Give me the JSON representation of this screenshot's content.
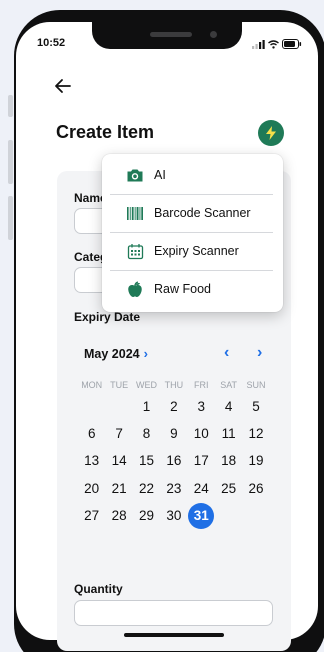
{
  "status": {
    "time": "10:52"
  },
  "header": {
    "title": "Create Item"
  },
  "form": {
    "name_label": "Name",
    "category_label": "Category",
    "expiry_label": "Expiry Date",
    "quantity_label": "Quantity"
  },
  "calendar": {
    "month_label": "May 2024",
    "weekdays": [
      "MON",
      "TUE",
      "WED",
      "THU",
      "FRI",
      "SAT",
      "SUN"
    ],
    "leading_blanks": 2,
    "days_in_month": 31,
    "selected_day": 31
  },
  "menu": {
    "items": [
      {
        "label": "AI",
        "icon": "camera-icon"
      },
      {
        "label": "Barcode Scanner",
        "icon": "barcode-icon"
      },
      {
        "label": "Expiry Scanner",
        "icon": "calendar-icon"
      },
      {
        "label": "Raw Food",
        "icon": "apple-icon"
      }
    ]
  },
  "colors": {
    "accent_green": "#1f7a57",
    "accent_blue": "#1f6fe5"
  }
}
